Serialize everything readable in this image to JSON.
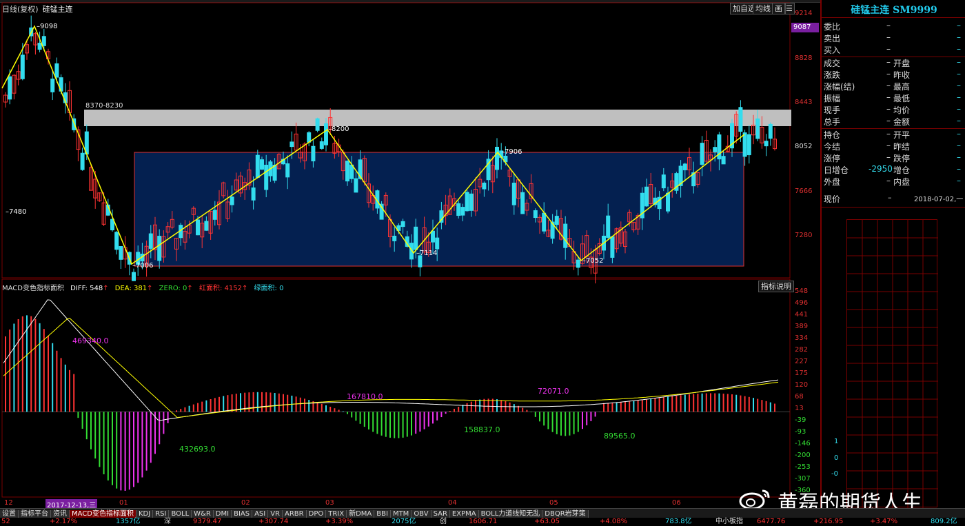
{
  "header": {
    "period": "日线(复权)",
    "name": "硅锰主连"
  },
  "toolbar": {
    "add_fav": "加自选",
    "avg": "均线",
    "icon": "画"
  },
  "y_ticks": {
    "t9214": "9214",
    "t8828": "8828",
    "t8443": "8443",
    "t8052": "8052",
    "t7666": "7666",
    "t7280": "7280"
  },
  "current_price": "9087",
  "zigzag": {
    "p9098": "9098",
    "p7480": "7480",
    "p7006": "7006",
    "p8200": "8200",
    "p7114": "7114",
    "p7906": "7906",
    "p7052": "7052"
  },
  "band_label": "8370-8230",
  "macd_header": {
    "name": "MACD变色指标面积",
    "diff": "DIFF: 548",
    "dea": "DEA: 381",
    "zero": "ZERO: 0",
    "red": "红面积: 4152",
    "green": "绿面积: 0"
  },
  "indicator_btn": "指标说明",
  "macd_ticks": [
    "548",
    "496",
    "441",
    "389",
    "334",
    "282",
    "227",
    "175",
    "120",
    "68",
    "13",
    "-39",
    "-93",
    "-146",
    "-200",
    "-253",
    "-307",
    "-360"
  ],
  "macd_labels": {
    "a1": "469340.0",
    "a2": "432693.0",
    "a3": "167810.0",
    "a4": "158837.0",
    "a5": "72071.0",
    "a6": "89565.0"
  },
  "x_labels": {
    "x12": "12",
    "x01": "01",
    "x02": "02",
    "x03": "03",
    "x04": "04",
    "x05": "05",
    "x06": "06"
  },
  "x_cursor_date": "2017-12-13,三",
  "tabs": [
    "设置",
    "指标平台",
    "资讯",
    "MACD变色指标面积",
    "KDJ",
    "RSI",
    "BOLL",
    "W&R",
    "DMI",
    "BIAS",
    "ASI",
    "VR",
    "ARBR",
    "DPO",
    "TRIX",
    "新DMA",
    "BBI",
    "MTM",
    "OBV",
    "SAR",
    "EXPMA",
    "BOLL力道线知无乱",
    "DBQR岩芽策"
  ],
  "status": {
    "s1": "52",
    "s2": "+2.17%",
    "s3": "1357亿",
    "s4": "深",
    "s5": "9379.47",
    "s6": "+307.74",
    "s7": "+3.39%",
    "s8": "2075亿",
    "s9": "创",
    "s10": "1606.71",
    "s11": "+63.05",
    "s12": "+4.08%",
    "s13": "783.8亿",
    "s14": "中小板指",
    "s15": "6477.76",
    "s16": "+216.95",
    "s17": "+3.47%",
    "s18": "809.2亿"
  },
  "panel": {
    "title": "硅锰主连 SM9999",
    "rows1": [
      {
        "l": "委比",
        "v": "–"
      },
      {
        "l": "卖出",
        "v": "–"
      },
      {
        "l": "买入",
        "v": "–"
      }
    ],
    "rows2": [
      {
        "l": "成交",
        "m": "–",
        "r": "开盘"
      },
      {
        "l": "涨跌",
        "m": "–",
        "r": "昨收"
      },
      {
        "l": "涨幅(结)",
        "m": "–",
        "r": "最高"
      },
      {
        "l": "振幅",
        "m": "–",
        "r": "最低"
      },
      {
        "l": "现手",
        "m": "–",
        "r": "均价"
      },
      {
        "l": "总手",
        "m": "–",
        "r": "金额"
      }
    ],
    "rows3": [
      {
        "l": "持仓",
        "m": "–",
        "r": "开平"
      },
      {
        "l": "今结",
        "m": "–",
        "r": "昨结"
      },
      {
        "l": "涨停",
        "m": "–",
        "r": "跌停"
      },
      {
        "l": "日增仓",
        "m": "-2950",
        "r": "增仓"
      },
      {
        "l": "外盘",
        "m": "–",
        "r": "内盘"
      }
    ],
    "now_label": "现价",
    "now_value": "–",
    "now_date": "2018-07-02,一",
    "grid_nums": {
      "g1": "1",
      "g0": "0",
      "gm": "-0"
    }
  },
  "watermark": "黄磊的期货人生",
  "colors": {
    "up": "#ff3333",
    "down": "#33ddee",
    "zigzag": "#ffff00",
    "box_fill": "#042050",
    "box_border": "#e03030",
    "band": "#bfbfbf",
    "macd_green": "#33dd33",
    "macd_magenta": "#ee33ee",
    "accent": "#7a1fa0"
  }
}
